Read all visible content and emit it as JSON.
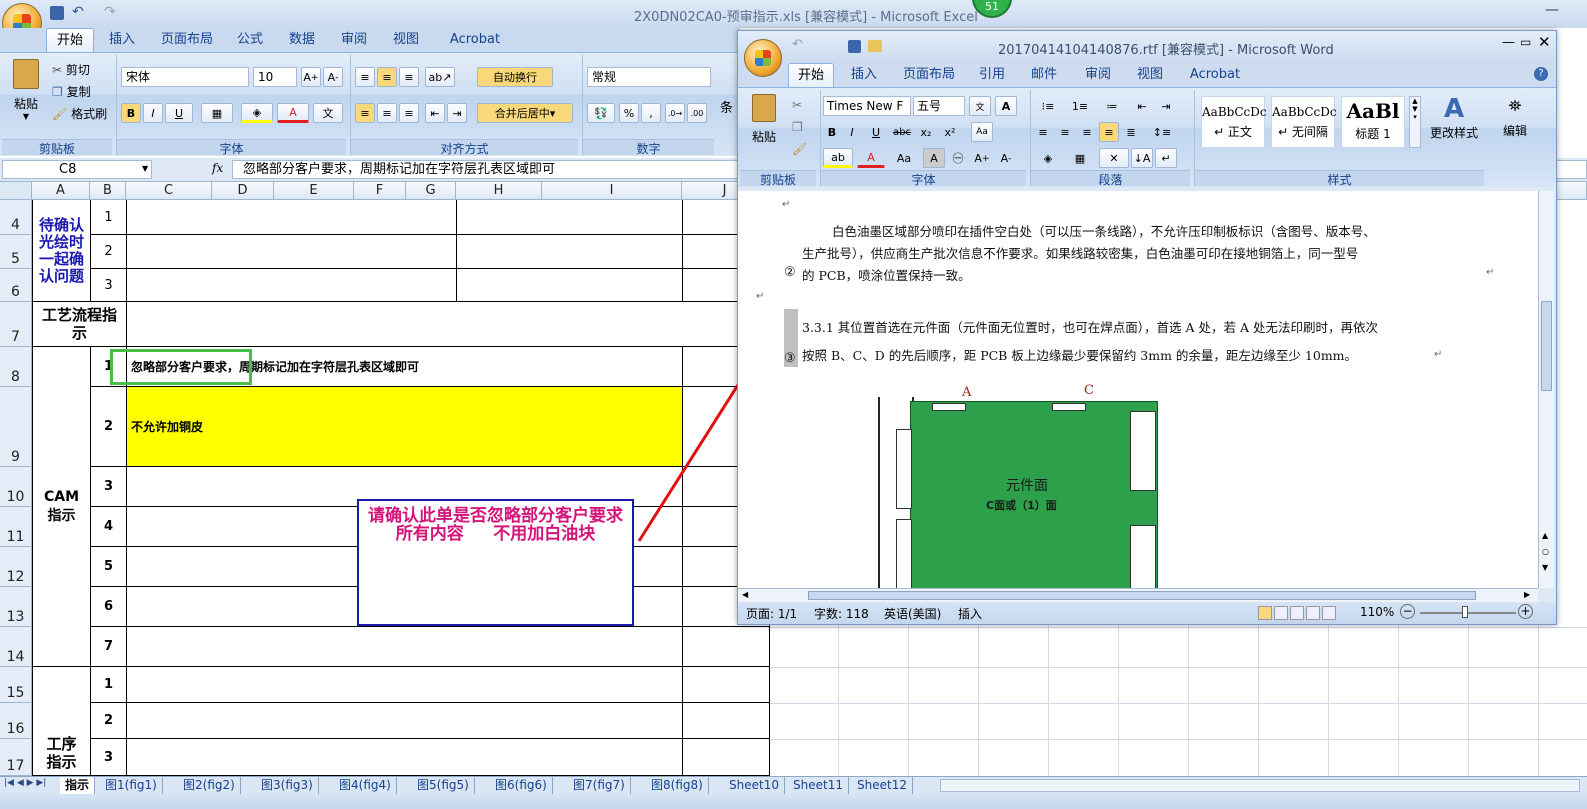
{
  "excel": {
    "title": "2X0DN02CA0-预审指示.xls  [兼容模式] - Microsoft Excel",
    "tabs": [
      "开始",
      "插入",
      "页面布局",
      "公式",
      "数据",
      "审阅",
      "视图",
      "Acrobat"
    ],
    "clipboard": {
      "paste": "粘贴",
      "cut": "剪切",
      "copy": "复制",
      "format_painter": "格式刷",
      "label": "剪贴板"
    },
    "font": {
      "name": "宋体",
      "size": "10",
      "label": "字体"
    },
    "alignment": {
      "wrap": "自动换行",
      "merge": "合并后居中",
      "label": "对齐方式"
    },
    "number": {
      "format": "常规",
      "label": "数字",
      "percent": "%",
      "comma": ","
    },
    "styles_partial": "条",
    "name_box": "C8",
    "fx": "fx",
    "formula": "忽略部分客户要求，周期标记加在字符层孔表区域即可",
    "columns": [
      "A",
      "B",
      "C",
      "D",
      "E",
      "F",
      "G",
      "H",
      "I",
      "J"
    ],
    "rows": [
      "4",
      "5",
      "6",
      "7",
      "8",
      "9",
      "10",
      "11",
      "12",
      "13",
      "14",
      "15",
      "16",
      "17"
    ],
    "cells": {
      "group_confirm": "待确认光绘时一起确认问题",
      "group_process": "工艺流程指示",
      "group_cam": "CAM指示",
      "group_step": "工序指示",
      "nums_confirm": [
        "1",
        "2",
        "3"
      ],
      "nums_cam": [
        "1",
        "2",
        "3",
        "4",
        "5",
        "6",
        "7"
      ],
      "nums_step": [
        "1",
        "2",
        "3"
      ],
      "c8": "忽略部分客户要求，周期标记加在字符层孔表区域即可",
      "c9": "不允许加铜皮"
    },
    "sheet_tabs": [
      "指示",
      "图1(fig1)",
      "图2(fig2)",
      "图3(fig3)",
      "图4(fig4)",
      "图5(fig5)",
      "图6(fig6)",
      "图7(fig7)",
      "图8(fig8)",
      "Sheet10",
      "Sheet11",
      "Sheet12"
    ],
    "notification_badge": "51"
  },
  "annotation": {
    "text": "请确认此单是否忽略部分客户要求所有内容     不用加白油块",
    "color": "#d4147a",
    "border_color": "#1a1aa8",
    "arrow_color": "#e01010"
  },
  "word": {
    "title": "20170414104140876.rtf [兼容模式] - Microsoft Word",
    "tabs": [
      "开始",
      "插入",
      "页面布局",
      "引用",
      "邮件",
      "审阅",
      "视图",
      "Acrobat"
    ],
    "clipboard": {
      "paste": "粘贴",
      "label": "剪贴板"
    },
    "font": {
      "name": "Times New F",
      "size": "五号",
      "label": "字体",
      "wen": "wén 文",
      "a_label": "A"
    },
    "paragraph_label": "段落",
    "styles": [
      {
        "preview": "AaBbCcDc",
        "name": "↵ 正文"
      },
      {
        "preview": "AaBbCcDc",
        "name": "↵ 无间隔"
      },
      {
        "preview": "AaBl",
        "name": "标题 1"
      }
    ],
    "change_styles": "更改样式",
    "styles_label": "样式",
    "edit": "编辑",
    "doc": {
      "para1_line1": "白色油墨区域部分喷印在插件空白处（可以压一条线路），不允许压印制板标识（含图号、版本号、",
      "para1_line2": "生产批号），供应商生产批次信息不作要求。如果线路较密集，白色油墨可印在接地铜箔上，同一型号",
      "para1_line3": "的 PCB，喷涂位置保持一致。",
      "marker2": "②",
      "para2_line1": "3.3.1 其位置首选在元件面（元件面无位置时，也可在焊点面），首选 A 处，若 A 处无法印刷时，再依次",
      "para2_line2": "按照 B、C、D 的先后顺序，距 PCB 板上边缘最少要保留约 3mm 的余量，距左边缘至少 10mm。",
      "marker3": "③",
      "fig_label_a": "A",
      "fig_label_c": "C",
      "fig_text1": "元件面",
      "fig_text2": "C面或（1）面"
    },
    "status": {
      "page": "页面: 1/1",
      "words": "字数: 118",
      "lang": "英语(美国)",
      "mode": "插入",
      "zoom": "110%"
    }
  }
}
